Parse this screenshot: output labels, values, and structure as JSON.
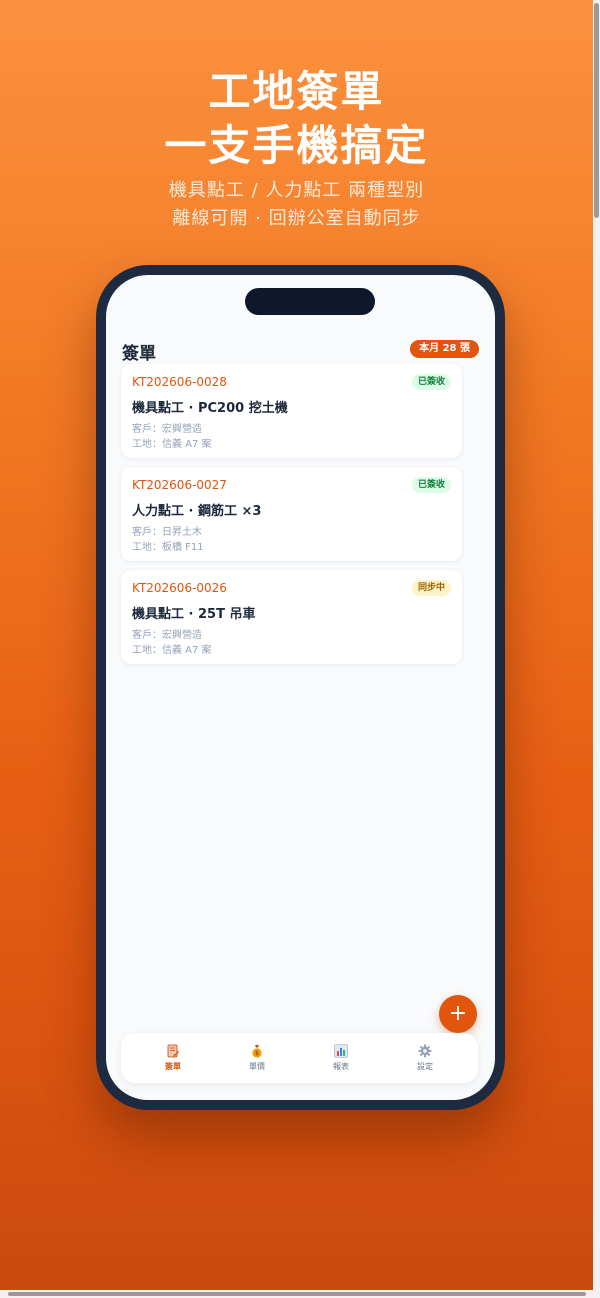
{
  "hero": {
    "line1": "工地簽單",
    "line2": "一支手機搞定",
    "sub1": "機具點工 / 人力點工 兩種型別",
    "sub2": "離線可開 · 回辦公室自動同步"
  },
  "screen": {
    "title": "簽單",
    "month_badge": "本月 28 張",
    "cards": [
      {
        "code": "KT202606-0028",
        "status": "已簽收",
        "name": "機具點工 · PC200 挖土機",
        "client": "客戶：宏興營造",
        "site": "工地：信義 A7 案"
      },
      {
        "code": "KT202606-0027",
        "status": "已簽收",
        "name": "人力點工 · 鋼筋工 ×3",
        "client": "客戶：日昇土木",
        "site": "工地：板橋 F11"
      },
      {
        "code": "KT202606-0026",
        "status": "同步中",
        "name": "機具點工 · 25T 吊車",
        "client": "客戶：宏興營造",
        "site": "工地：信義 A7 案"
      }
    ],
    "fab_label": "+",
    "tabs": [
      {
        "label": "簽單",
        "icon": "document-edit-icon"
      },
      {
        "label": "單價",
        "icon": "money-bag-icon"
      },
      {
        "label": "報表",
        "icon": "bar-chart-icon"
      },
      {
        "label": "設定",
        "icon": "gear-icon"
      }
    ]
  },
  "colors": {
    "accent": "#e0560f",
    "phone_frame": "#1e2a3f",
    "status_done_bg": "#dcfce7",
    "status_sync_bg": "#fef3c7"
  }
}
